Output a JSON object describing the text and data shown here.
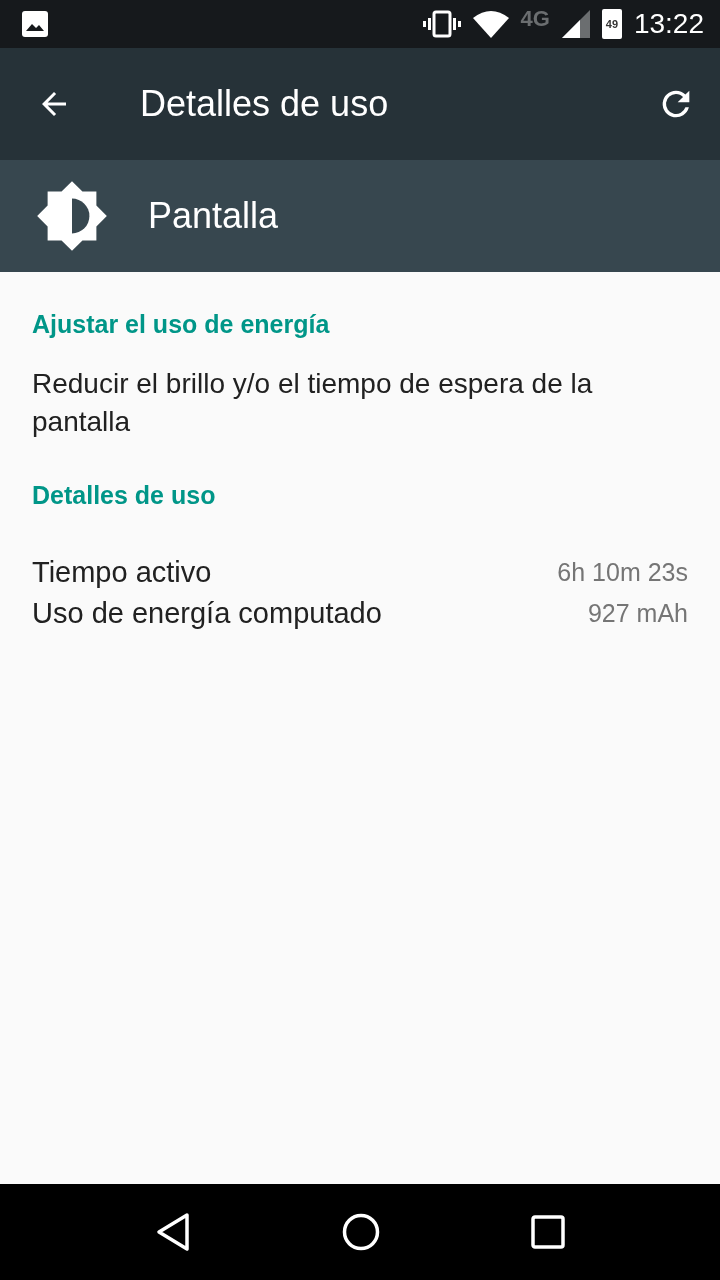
{
  "status_bar": {
    "network": "4G",
    "battery": "49",
    "time": "13:22"
  },
  "app_bar": {
    "title": "Detalles de uso"
  },
  "header": {
    "title": "Pantalla"
  },
  "sections": [
    {
      "kind": "text",
      "title": "Ajustar el uso de energía",
      "text": "Reducir el brillo y/o el tiempo de espera de la pantalla"
    },
    {
      "kind": "stats",
      "title": "Detalles de uso",
      "rows": [
        {
          "label": "Tiempo activo",
          "value": "6h 10m 23s"
        },
        {
          "label": "Uso de energía computado",
          "value": "927 mAh"
        }
      ]
    }
  ]
}
